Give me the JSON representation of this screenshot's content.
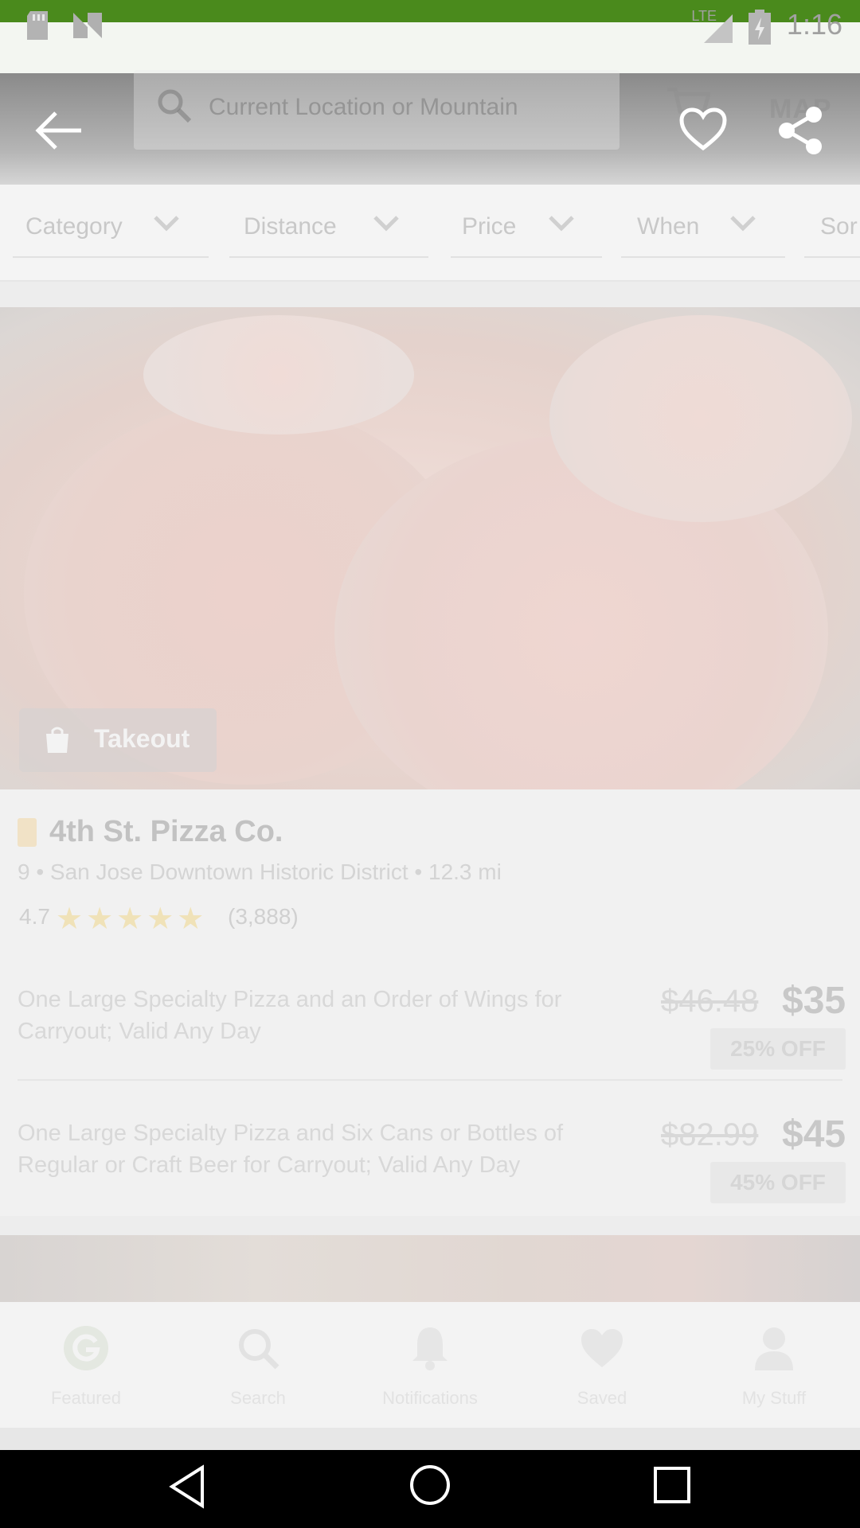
{
  "status_bar": {
    "network": "LTE",
    "time": "1:16",
    "icons": [
      "sd-card-icon",
      "notification-n-icon",
      "signal-icon",
      "battery-charging-icon"
    ]
  },
  "header": {
    "search_text": "Current Location or Mountain",
    "map_label": "MAP"
  },
  "overlay_actions": {
    "back": "back-arrow-icon",
    "favorite": "heart-outline-icon",
    "share": "share-icon"
  },
  "filters": [
    {
      "label": "Category"
    },
    {
      "label": "Distance"
    },
    {
      "label": "Price"
    },
    {
      "label": "When"
    },
    {
      "label": "Sor"
    }
  ],
  "card": {
    "badge": "Takeout",
    "business_name": "4th St. Pizza Co.",
    "location": "9 • San Jose Downtown Historic District • 12.3 mi",
    "rating": "4.7",
    "stars": "★★★★★",
    "rating_count": "(3,888)",
    "deals": [
      {
        "title": "One Large Specialty Pizza and an Order of Wings for Carryout; Valid Any Day",
        "old_price": "$46.48",
        "new_price": "$35",
        "discount": "25% OFF"
      },
      {
        "title": "One Large Specialty Pizza and Six Cans or Bottles of Regular or Craft Beer for Carryout; Valid Any Day",
        "old_price": "$82.99",
        "new_price": "$45",
        "discount": "45% OFF"
      }
    ]
  },
  "bottom_nav": [
    {
      "label": "Featured",
      "icon": "groupon-g-icon"
    },
    {
      "label": "Search",
      "icon": "search-icon"
    },
    {
      "label": "Notifications",
      "icon": "bell-icon"
    },
    {
      "label": "Saved",
      "icon": "heart-icon"
    },
    {
      "label": "My Stuff",
      "icon": "person-icon"
    }
  ],
  "system_nav": {
    "back": "back-triangle-icon",
    "home": "home-circle-icon",
    "recents": "recents-square-icon"
  },
  "colors": {
    "status_bar": "#4a8a1c",
    "overlay_icon": "#ffffff",
    "system_nav": "#000000"
  }
}
